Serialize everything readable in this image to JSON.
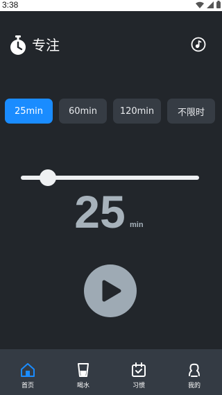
{
  "status_bar": {
    "time": "3:38"
  },
  "header": {
    "title": "专注"
  },
  "presets": [
    {
      "label": "25min",
      "active": true
    },
    {
      "label": "60min",
      "active": false
    },
    {
      "label": "120min",
      "active": false
    },
    {
      "label": "不限时",
      "active": false
    }
  ],
  "slider": {
    "value_fraction": 0.15
  },
  "timer": {
    "minutes": "25",
    "unit": "min"
  },
  "nav": {
    "items": [
      {
        "label": "首页",
        "icon": "home-icon",
        "active": true
      },
      {
        "label": "喝水",
        "icon": "cup-icon",
        "active": false
      },
      {
        "label": "习惯",
        "icon": "calendar-check-icon",
        "active": false
      },
      {
        "label": "我的",
        "icon": "profile-icon",
        "active": false
      }
    ]
  },
  "colors": {
    "background": "#22262b",
    "accent": "#1a8cff",
    "preset_bg": "#363c44",
    "digits": "#a7b2bb",
    "nav_bg": "#343b44"
  }
}
